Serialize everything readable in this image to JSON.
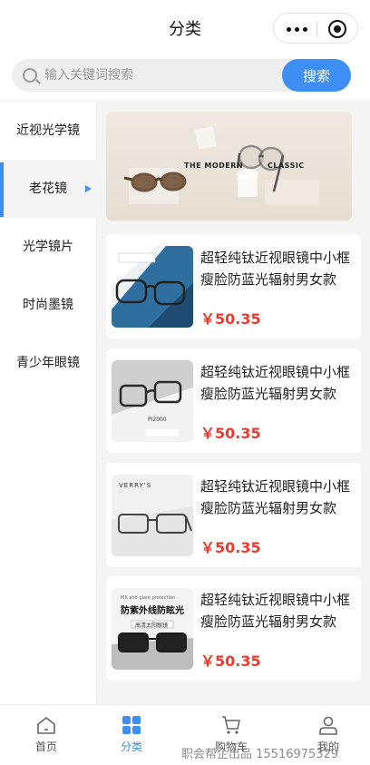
{
  "header": {
    "title": "分类"
  },
  "search": {
    "placeholder": "输入关键词搜索",
    "button_label": "搜索"
  },
  "sidebar": {
    "items": [
      {
        "label": "近视光学镜"
      },
      {
        "label": "老花镜",
        "active": true
      },
      {
        "label": "光学镜片"
      },
      {
        "label": "时尚墨镜"
      },
      {
        "label": "青少年眼镜"
      }
    ]
  },
  "banner": {
    "text_left": "THE MODERN",
    "text_right": "CLASSIC"
  },
  "products": [
    {
      "name": "超轻纯钛近视眼镜中小框瘦脸防蓝光辐射男女款",
      "price": "￥50.35"
    },
    {
      "name": "超轻纯钛近视眼镜中小框瘦脸防蓝光辐射男女款",
      "price": "￥50.35"
    },
    {
      "name": "超轻纯钛近视眼镜中小框瘦脸防蓝光辐射男女款",
      "price": "￥50.35"
    },
    {
      "name": "超轻纯钛近视眼镜中小框瘦脸防蓝光辐射男女款",
      "price": "￥50.35"
    }
  ],
  "product_images": {
    "img2_tag": "PI2000",
    "img3_brand": "VERRY'S",
    "img4_en": "MX and glare protection",
    "img4_title": "防紫外线防眩光",
    "img4_sub": "高清太阳眼镜"
  },
  "tabbar": {
    "tabs": [
      {
        "label": "首页",
        "icon": "home-icon"
      },
      {
        "label": "分类",
        "icon": "category-icon",
        "active": true
      },
      {
        "label": "购物车",
        "icon": "cart-icon"
      },
      {
        "label": "我的",
        "icon": "user-icon"
      }
    ]
  },
  "watermark": "职会帮企出品 15516975329",
  "colors": {
    "accent": "#3d8ff6",
    "price": "#ee3a2d"
  }
}
